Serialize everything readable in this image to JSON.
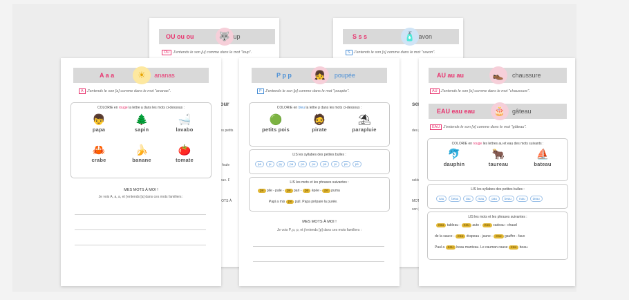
{
  "cards": {
    "ou": {
      "big": "OU ou ou",
      "word": "loup",
      "sound": "J'entends le son [u] comme dans le mot \"loup\".",
      "tag": "OU",
      "icon": "🐺"
    },
    "s": {
      "big": "S s s",
      "word": "savon",
      "sound": "J'entends le son [s] comme dans le mot \"savon\".",
      "tag": "S",
      "icon": "🧴"
    },
    "a": {
      "big": "A a a",
      "word": "ananas",
      "tag": "A",
      "icon": "☀",
      "sound": "J'entends le son [a] comme dans le mot \"ananas\".",
      "colorie": {
        "pre": "COLORIE en ",
        "red": "rouge",
        "post": " la lettre a dans les mots ci-dessous :"
      },
      "items": [
        {
          "icon": "👦",
          "label": "papa"
        },
        {
          "icon": "🌲",
          "label": "sapin"
        },
        {
          "icon": "🛁",
          "label": "lavabo"
        },
        {
          "icon": "🦀",
          "label": "crabe"
        },
        {
          "icon": "🍌",
          "label": "banane"
        },
        {
          "icon": "🍅",
          "label": "tomate"
        }
      ],
      "mots_title": "MES MOTS À MOI !",
      "mots_text": "Je vois A, a, a, et j'entends [a] dans ces mots familiers :"
    },
    "p": {
      "big": "P p p",
      "word": "poupée",
      "tag": "P",
      "icon": "👧",
      "sound": "J'entends le son [p] comme dans le mot \"poupée\".",
      "colorie": {
        "pre": "COLORIE en ",
        "blue": "bleu",
        "post": " la lettre p dans les mots ci-dessous :"
      },
      "items": [
        {
          "icon": "🟢",
          "label": "petits pois"
        },
        {
          "icon": "🧔",
          "label": "pirate"
        },
        {
          "icon": "⛱",
          "label": "parapluie"
        }
      ],
      "syl_title": "LIS les syllabes des petites bulles :",
      "syllables": [
        "pa",
        "pi",
        "py",
        "pa",
        "po",
        "pu",
        "pé",
        "pi",
        "pe",
        "pè"
      ],
      "lis_title": "LIS les mots et les phrases suivantes :",
      "lines": [
        [
          "pile - pale - ",
          "pe",
          " pari - ",
          "pe",
          " épée - ",
          "pe",
          " puma"
        ],
        [
          "Papi a mis ",
          "pe",
          " pull. Papa prépare la purée."
        ]
      ],
      "mots_title": "MES MOTS À MOI !",
      "mots_text": "Je vois P, p, p, et j'entends [p] dans ces mots familiers :"
    },
    "au": {
      "big": "AU au au",
      "word": "chaussure",
      "tag": "AU",
      "icon": "👞",
      "sound": "J'entends le son [o] comme dans le mot \"chaussure\".",
      "big2": "EAU eau eau",
      "word2": "gâteau",
      "tag2": "EAU",
      "icon2": "🎂",
      "sound2": "J'entends le son [o] comme dans le mot \"gâteau\".",
      "colorie": {
        "pre": "COLORIE en ",
        "red": "rouge",
        "post": " les lettres au et eau des mots suivants :"
      },
      "items": [
        {
          "icon": "🐬",
          "label": "dauphin"
        },
        {
          "icon": "🐂",
          "label": "taureau"
        },
        {
          "icon": "⛵",
          "label": "bateau"
        }
      ],
      "syl_title": "LIS les syllabes des petites bulles :",
      "syllables": [
        "sau",
        "beau",
        "tau",
        "mau",
        "pau",
        "beau",
        "mau",
        "deau"
      ],
      "lis_title": "LIS les mots et les phrases suivantes :",
      "lines": [
        [
          "",
          "eau",
          " tableau - ",
          "eau",
          " auto - ",
          "eau",
          " cadeau - chaud"
        ],
        [
          "de la sauce - ",
          "eau",
          " drapeau - jaune - ",
          "eau",
          " gauffre - faux"
        ],
        [
          "Paul a ",
          "eau",
          " beau manteau. Le cauman cause ",
          "eau",
          " beau."
        ]
      ]
    }
  },
  "fragments": {
    "ou_left": "four",
    "ou_right": "serpent",
    "back1": "des petits",
    "back2": "la foule",
    "back3": "poux. F",
    "back4": "MOTS À",
    "back5": "J'entends le son [s] comme",
    "back6": "des pe",
    "back7": "seléc",
    "back8": "MOTS",
    "back9": "son [s] dans"
  },
  "colors": {
    "accent_red": "#e8336e",
    "accent_blue": "#4a8fd6",
    "header_gray": "#d9d9d9",
    "bubble_gold": "#e0b634"
  }
}
